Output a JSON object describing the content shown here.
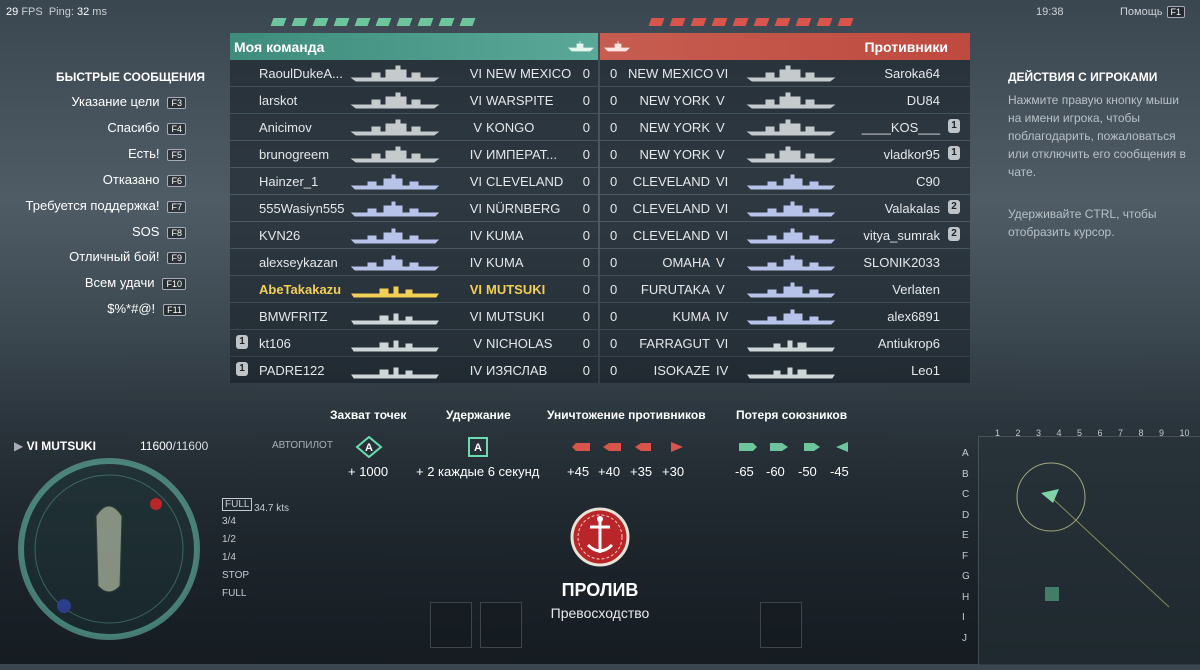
{
  "hud": {
    "fps": "29",
    "fps_label": "FPS",
    "ping_label": "Ping:",
    "ping": "32",
    "ping_unit": "ms",
    "clock": "19:38",
    "help_label": "Помощь",
    "help_key": "F1"
  },
  "capture_marks": {
    "ally_count": 10,
    "enemy_count": 10,
    "ally_color": "#6cc59c",
    "enemy_color": "#d9544a"
  },
  "teams": {
    "ally_title": "Моя команда",
    "enemy_title": "Противники"
  },
  "ally_rows": [
    {
      "division": "",
      "player": "RaoulDukeA...",
      "tier": "VI",
      "ship": "NEW MEXICO",
      "frags": "0",
      "class": "bb",
      "me": false
    },
    {
      "division": "",
      "player": "larskot",
      "tier": "VI",
      "ship": "WARSPITE",
      "frags": "0",
      "class": "bb",
      "me": false
    },
    {
      "division": "",
      "player": "Anicimov",
      "tier": "V",
      "ship": "KONGO",
      "frags": "0",
      "class": "bb",
      "me": false
    },
    {
      "division": "",
      "player": "brunogreem",
      "tier": "IV",
      "ship": "ИМПЕРАТ...",
      "frags": "0",
      "class": "bb",
      "me": false
    },
    {
      "division": "",
      "player": "Hainzer_1",
      "tier": "VI",
      "ship": "CLEVELAND",
      "frags": "0",
      "class": "ca",
      "me": false
    },
    {
      "division": "",
      "player": "555Wasiyn555",
      "tier": "VI",
      "ship": "NÜRNBERG",
      "frags": "0",
      "class": "ca",
      "me": false
    },
    {
      "division": "",
      "player": "KVN26",
      "tier": "IV",
      "ship": "KUMA",
      "frags": "0",
      "class": "ca",
      "me": false
    },
    {
      "division": "",
      "player": "alexseykazan",
      "tier": "IV",
      "ship": "KUMA",
      "frags": "0",
      "class": "ca",
      "me": false
    },
    {
      "division": "",
      "player": "AbeTakakazu",
      "tier": "VI",
      "ship": "MUTSUKI",
      "frags": "0",
      "class": "dd",
      "me": true
    },
    {
      "division": "",
      "player": "BMWFRITZ",
      "tier": "VI",
      "ship": "MUTSUKI",
      "frags": "0",
      "class": "dd",
      "me": false
    },
    {
      "division": "1",
      "player": "kt106",
      "tier": "V",
      "ship": "NICHOLAS",
      "frags": "0",
      "class": "dd",
      "me": false
    },
    {
      "division": "1",
      "player": "PADRE122",
      "tier": "IV",
      "ship": "ИЗЯСЛАВ",
      "frags": "0",
      "class": "dd",
      "me": false
    }
  ],
  "enemy_rows": [
    {
      "frags": "0",
      "ship": "NEW MEXICO",
      "tier": "VI",
      "player": "Saroka64",
      "division": "",
      "class": "bb"
    },
    {
      "frags": "0",
      "ship": "NEW YORK",
      "tier": "V",
      "player": "DU84",
      "division": "",
      "class": "bb"
    },
    {
      "frags": "0",
      "ship": "NEW YORK",
      "tier": "V",
      "player": "____KOS___",
      "division": "1",
      "class": "bb"
    },
    {
      "frags": "0",
      "ship": "NEW YORK",
      "tier": "V",
      "player": "vladkor95",
      "division": "1",
      "class": "bb"
    },
    {
      "frags": "0",
      "ship": "CLEVELAND",
      "tier": "VI",
      "player": "C90",
      "division": "",
      "class": "ca"
    },
    {
      "frags": "0",
      "ship": "CLEVELAND",
      "tier": "VI",
      "player": "Valakalas",
      "division": "2",
      "class": "ca"
    },
    {
      "frags": "0",
      "ship": "CLEVELAND",
      "tier": "VI",
      "player": "vitya_sumrak",
      "division": "2",
      "class": "ca"
    },
    {
      "frags": "0",
      "ship": "OMAHA",
      "tier": "V",
      "player": "SLONIK2033",
      "division": "",
      "class": "ca"
    },
    {
      "frags": "0",
      "ship": "FURUTAKA",
      "tier": "V",
      "player": "Verlaten",
      "division": "",
      "class": "ca"
    },
    {
      "frags": "0",
      "ship": "KUMA",
      "tier": "IV",
      "player": "alex6891",
      "division": "",
      "class": "ca"
    },
    {
      "frags": "0",
      "ship": "FARRAGUT",
      "tier": "VI",
      "player": "Antiukrop6",
      "division": "",
      "class": "dd"
    },
    {
      "frags": "0",
      "ship": "ISOKAZE",
      "tier": "IV",
      "player": "Leo1",
      "division": "",
      "class": "dd"
    }
  ],
  "quick_messages": {
    "title": "БЫСТРЫЕ СООБЩЕНИЯ",
    "items": [
      {
        "label": "Указание цели",
        "key": "F3"
      },
      {
        "label": "Спасибо",
        "key": "F4"
      },
      {
        "label": "Есть!",
        "key": "F5"
      },
      {
        "label": "Отказано",
        "key": "F6"
      },
      {
        "label": "Требуется поддержка!",
        "key": "F7"
      },
      {
        "label": "SOS",
        "key": "F8"
      },
      {
        "label": "Отличный бой!",
        "key": "F9"
      },
      {
        "label": "Всем удачи",
        "key": "F10"
      },
      {
        "label": "$%*#@!",
        "key": "F11"
      }
    ]
  },
  "player_actions": {
    "title": "ДЕЙСТВИЯ С ИГРОКАМИ",
    "hint1": "Нажмите правую кнопку мыши на имени игрока, чтобы поблагодарить, пожаловаться или отключить его сообщения в чате.",
    "hint2": "Удерживайте CTRL, чтобы отобразить курсор."
  },
  "rules": {
    "capture": {
      "title": "Захват точек",
      "icon": "A",
      "value": "+ 1000"
    },
    "hold": {
      "title": "Удержание",
      "icon": "A",
      "value": "+ 2 каждые 6 секунд"
    },
    "destroy": {
      "title": "Уничтожение противников",
      "values": [
        "+45",
        "+40",
        "+35",
        "+30"
      ]
    },
    "loss": {
      "title": "Потеря союзников",
      "values": [
        "-65",
        "-60",
        "-50",
        "-45"
      ]
    }
  },
  "mode": {
    "name": "ПРОЛИВ",
    "type": "Превосходство"
  },
  "own_ship": {
    "name": "VI MUTSUKI",
    "hp_current": "11600",
    "hp_max": "/11600",
    "autopilot": "АВТОПИЛОТ",
    "speed": "34.7 kts"
  },
  "gears": [
    "FULL",
    "3/4",
    "1/2",
    "1/4",
    "STOP",
    "FULL"
  ],
  "minimap_rows": [
    "A",
    "B",
    "C",
    "D",
    "E",
    "F",
    "G",
    "H",
    "I",
    "J"
  ],
  "minimap_cols": [
    "1",
    "2",
    "3",
    "4",
    "5",
    "6",
    "7",
    "8",
    "9",
    "10"
  ]
}
